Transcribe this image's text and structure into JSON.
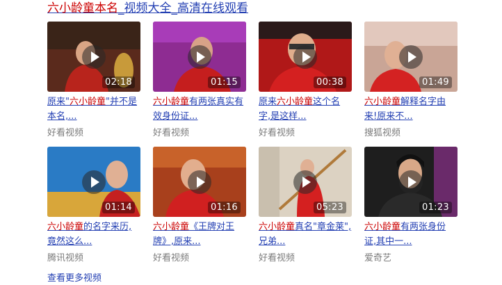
{
  "header": {
    "title_highlight": "六小龄童本名",
    "title_rest": "_视频大全_高清在线观看"
  },
  "videos": [
    {
      "duration": "02:18",
      "title_prefix": "原来\"",
      "title_highlight": "六小龄童",
      "title_rest": "\"并不是本名,...",
      "source": "好看视频"
    },
    {
      "duration": "01:15",
      "title_prefix": "",
      "title_highlight": "六小龄童",
      "title_rest": "有两张真实有效身份证...",
      "source": "好看视频"
    },
    {
      "duration": "00:38",
      "title_prefix": "原来",
      "title_highlight": "六小龄童",
      "title_rest": "这个名字,是这样...",
      "source": "好看视频"
    },
    {
      "duration": "01:49",
      "title_prefix": "",
      "title_highlight": "六小龄童",
      "title_rest": "解释名字由来!原来不...",
      "source": "搜狐视频"
    },
    {
      "duration": "01:14",
      "title_prefix": "",
      "title_highlight": "六小龄童",
      "title_rest": "的名字来历,竟然这么...",
      "source": "腾讯视频"
    },
    {
      "duration": "01:16",
      "title_prefix": "",
      "title_highlight": "六小龄童",
      "title_rest": "《王牌对王牌》,原来...",
      "source": "好看视频"
    },
    {
      "duration": "05:23",
      "title_prefix": "",
      "title_highlight": "六小龄童",
      "title_rest": "真名\"章金莱\",兄弟...",
      "source": "好看视频"
    },
    {
      "duration": "01:23",
      "title_prefix": "",
      "title_highlight": "六小龄童",
      "title_rest": "有两张身份证,其中一...",
      "source": "爱奇艺"
    }
  ],
  "thumb_colors": [
    "#6a2a1e",
    "#8c2a8a",
    "#c61d1d",
    "#c8a090",
    "#2d7fc8",
    "#b8451f",
    "#d8cfc0",
    "#242424"
  ],
  "footer": {
    "more_label": "查看更多视频"
  }
}
